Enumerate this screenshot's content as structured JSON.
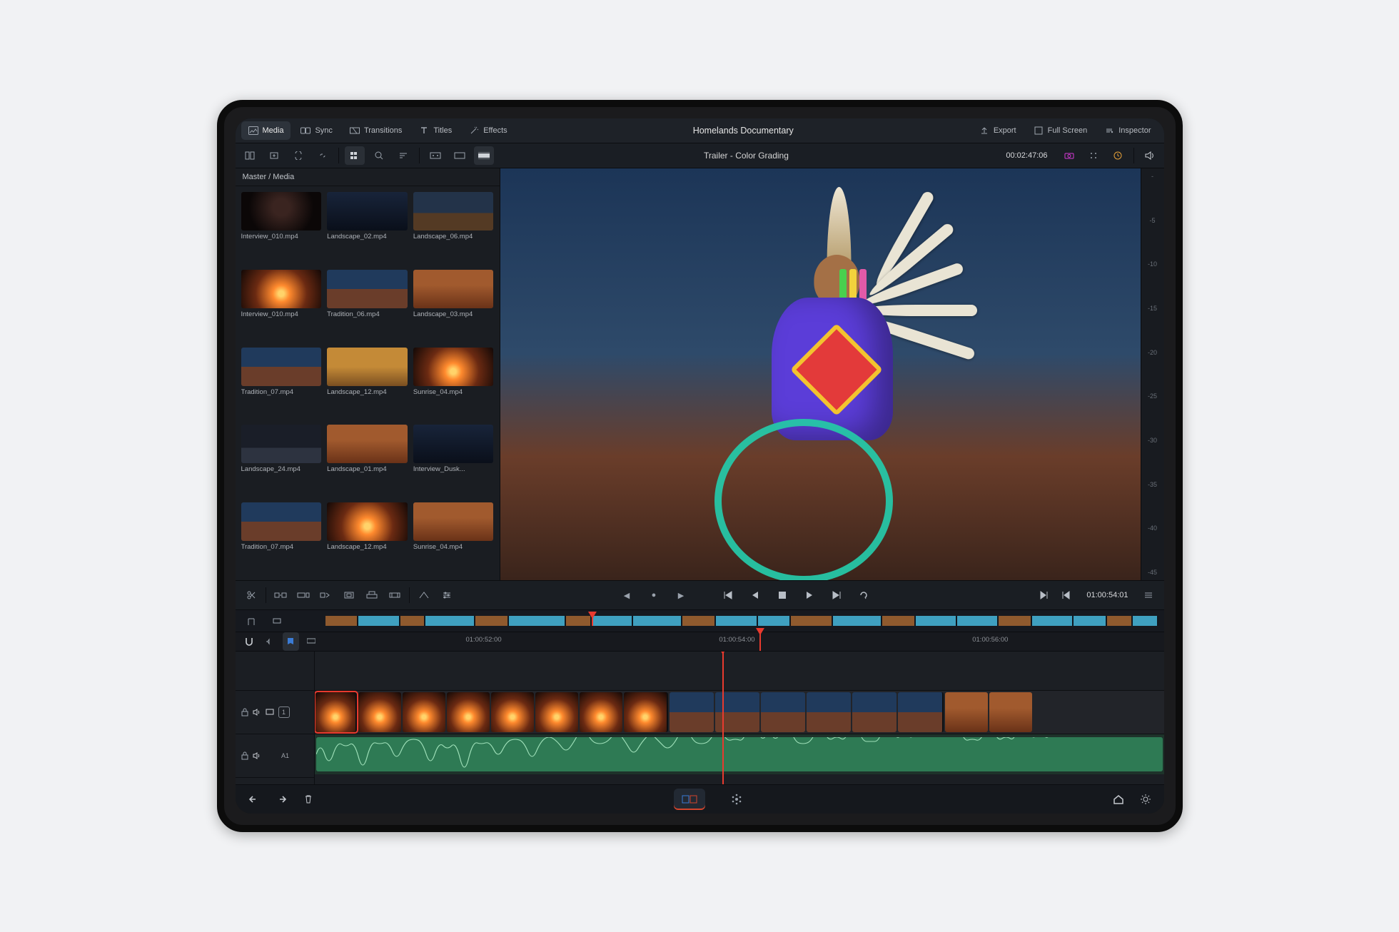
{
  "project_title": "Homelands Documentary",
  "top_tabs": [
    {
      "icon": "image",
      "label": "Media"
    },
    {
      "icon": "sync",
      "label": "Sync"
    },
    {
      "icon": "transition",
      "label": "Transitions"
    },
    {
      "icon": "text",
      "label": "Titles"
    },
    {
      "icon": "wand",
      "label": "Effects"
    }
  ],
  "top_right": [
    {
      "icon": "upload",
      "label": "Export"
    },
    {
      "icon": "fullscreen",
      "label": "Full Screen"
    },
    {
      "icon": "inspector",
      "label": "Inspector"
    }
  ],
  "viewer_title": "Trailer - Color Grading",
  "viewer_tc": "00:02:47:06",
  "transport_tc": "01:00:54:01",
  "breadcrumb": "Master / Media",
  "clips": [
    {
      "name": "Interview_010.mp4",
      "g": "g-int"
    },
    {
      "name": "Landscape_02.mp4",
      "g": "g-night"
    },
    {
      "name": "Landscape_06.mp4",
      "g": "g-land"
    },
    {
      "name": "Interview_010.mp4",
      "g": "g-sun"
    },
    {
      "name": "Tradition_06.mp4",
      "g": "g-trad"
    },
    {
      "name": "Landscape_03.mp4",
      "g": "g-rock"
    },
    {
      "name": "Tradition_07.mp4",
      "g": "g-trad"
    },
    {
      "name": "Landscape_12.mp4",
      "g": "g-field"
    },
    {
      "name": "Sunrise_04.mp4",
      "g": "g-sun"
    },
    {
      "name": "Landscape_24.mp4",
      "g": "g-dusk"
    },
    {
      "name": "Landscape_01.mp4",
      "g": "g-rock"
    },
    {
      "name": "Interview_Dusk...",
      "g": "g-night"
    },
    {
      "name": "Tradition_07.mp4",
      "g": "g-trad"
    },
    {
      "name": "Landscape_12.mp4",
      "g": "g-sun"
    },
    {
      "name": "Sunrise_04.mp4",
      "g": "g-rock"
    }
  ],
  "scope_ticks": [
    "-",
    "-5",
    "-10",
    "-15",
    "-20",
    "-25",
    "-30",
    "-35",
    "-40",
    "-45"
  ],
  "ruler_ticks": [
    {
      "t": "01:00:52:00",
      "pct": 18
    },
    {
      "t": "01:00:54:00",
      "pct": 48
    },
    {
      "t": "01:00:56:00",
      "pct": 78
    }
  ],
  "tracks": {
    "video": "1",
    "audio": "A1"
  },
  "colors": {
    "accent": "#e83a2e",
    "audio": "#2e7a54",
    "zoom": "#3fa0c0"
  }
}
